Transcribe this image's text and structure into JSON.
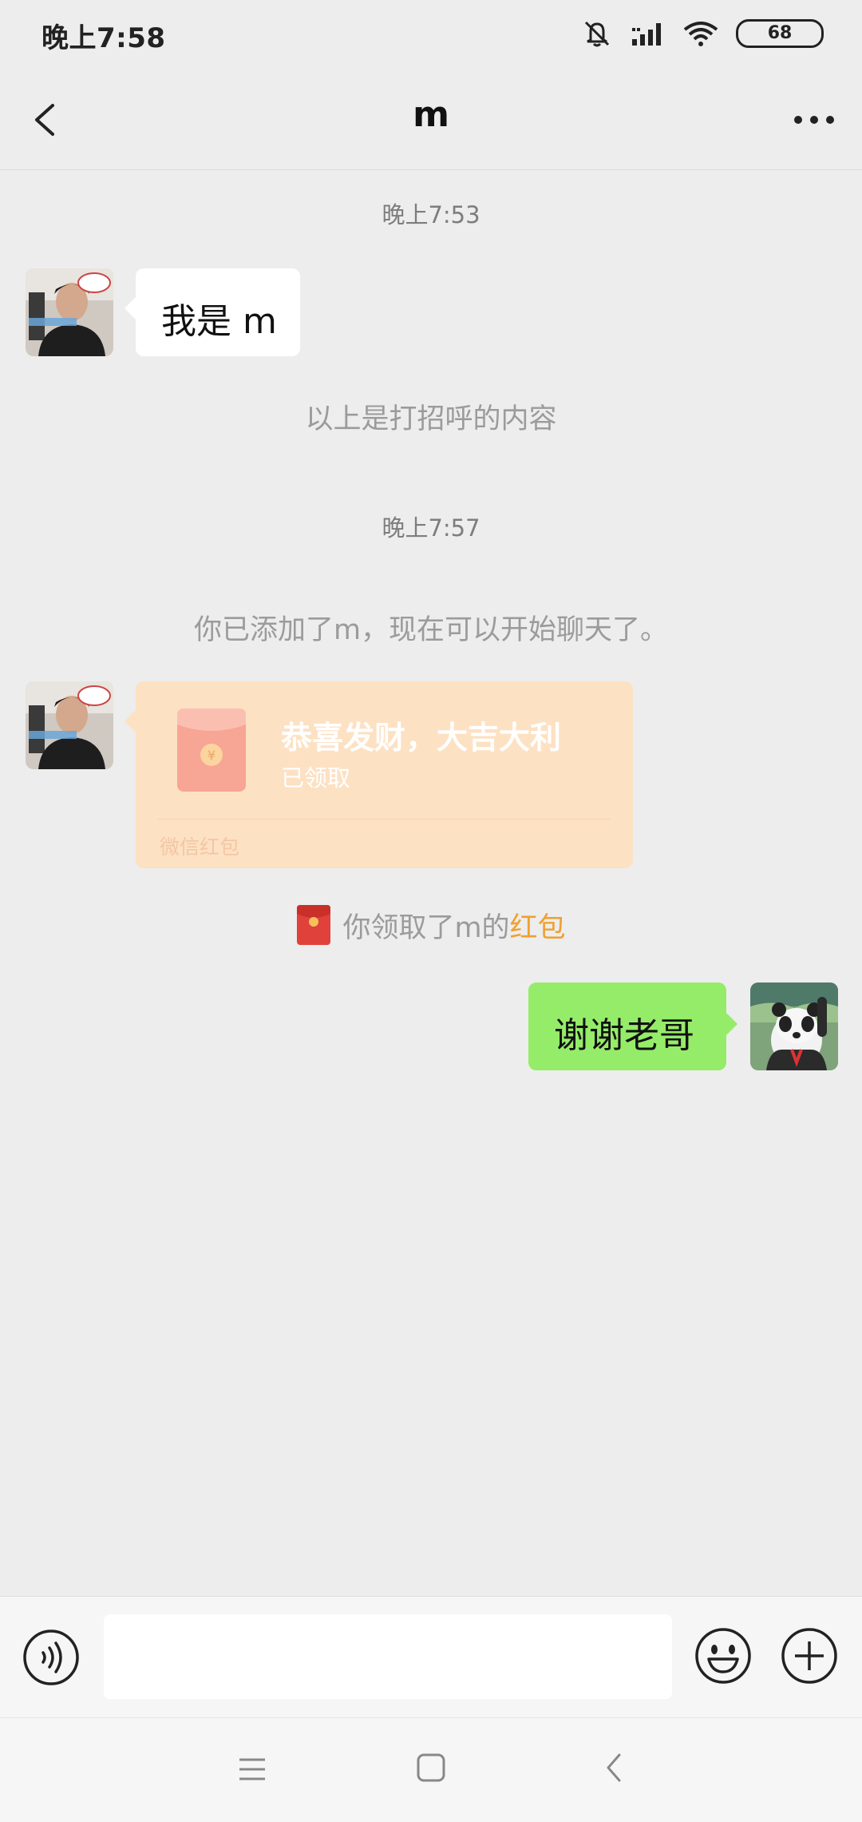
{
  "status_bar": {
    "time": "晚上7:58",
    "battery": "68"
  },
  "header": {
    "title": "m"
  },
  "messages": {
    "timestamp_1": "晚上7:53",
    "msg_1": "我是 m",
    "greeting_note": "以上是打招呼的内容",
    "timestamp_2": "晚上7:57",
    "added_note": "你已添加了m，现在可以开始聊天了。",
    "red_packet": {
      "title": "恭喜发财，大吉大利",
      "status": "已领取",
      "footer": "微信红包"
    },
    "received_note_prefix": "你领取了m的",
    "received_note_link": "红包",
    "msg_2": "谢谢老哥"
  },
  "input": {
    "placeholder": ""
  },
  "colors": {
    "background": "#ededed",
    "sent_bubble": "#95ec69",
    "red_packet_bg": "#fde1c3",
    "link_orange": "#f0a030"
  }
}
